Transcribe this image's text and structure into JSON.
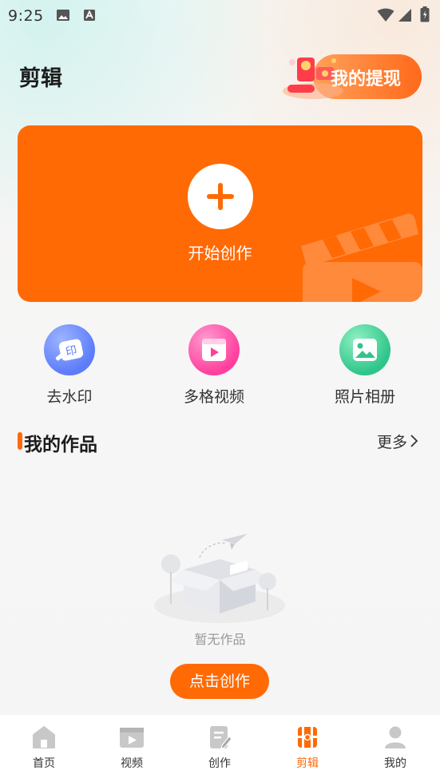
{
  "status_bar": {
    "time": "9:25",
    "icons": [
      "gallery-notification-icon",
      "a-notification-icon",
      "wifi-icon",
      "signal-icon",
      "battery-icon"
    ]
  },
  "header": {
    "title": "剪辑",
    "withdraw_label": "我的提现"
  },
  "create_card": {
    "label": "开始创作"
  },
  "tools": [
    {
      "label": "去水印",
      "icon": "watermark-remove-icon",
      "color": "#6b8cff"
    },
    {
      "label": "多格视频",
      "icon": "multi-grid-video-icon",
      "color": "#ff4fa6"
    },
    {
      "label": "照片相册",
      "icon": "photo-album-icon",
      "color": "#2fc58a"
    }
  ],
  "works": {
    "title": "我的作品",
    "more_label": "更多",
    "empty_text": "暂无作品",
    "cta_label": "点击创作"
  },
  "nav": {
    "items": [
      {
        "label": "首页",
        "icon": "home-icon"
      },
      {
        "label": "视频",
        "icon": "video-icon"
      },
      {
        "label": "创作",
        "icon": "create-icon"
      },
      {
        "label": "剪辑",
        "icon": "edit-clip-icon",
        "active": true
      },
      {
        "label": "我的",
        "icon": "profile-icon"
      }
    ]
  },
  "colors": {
    "accent": "#ff6a05",
    "nav_inactive": "#c8c8c8"
  }
}
